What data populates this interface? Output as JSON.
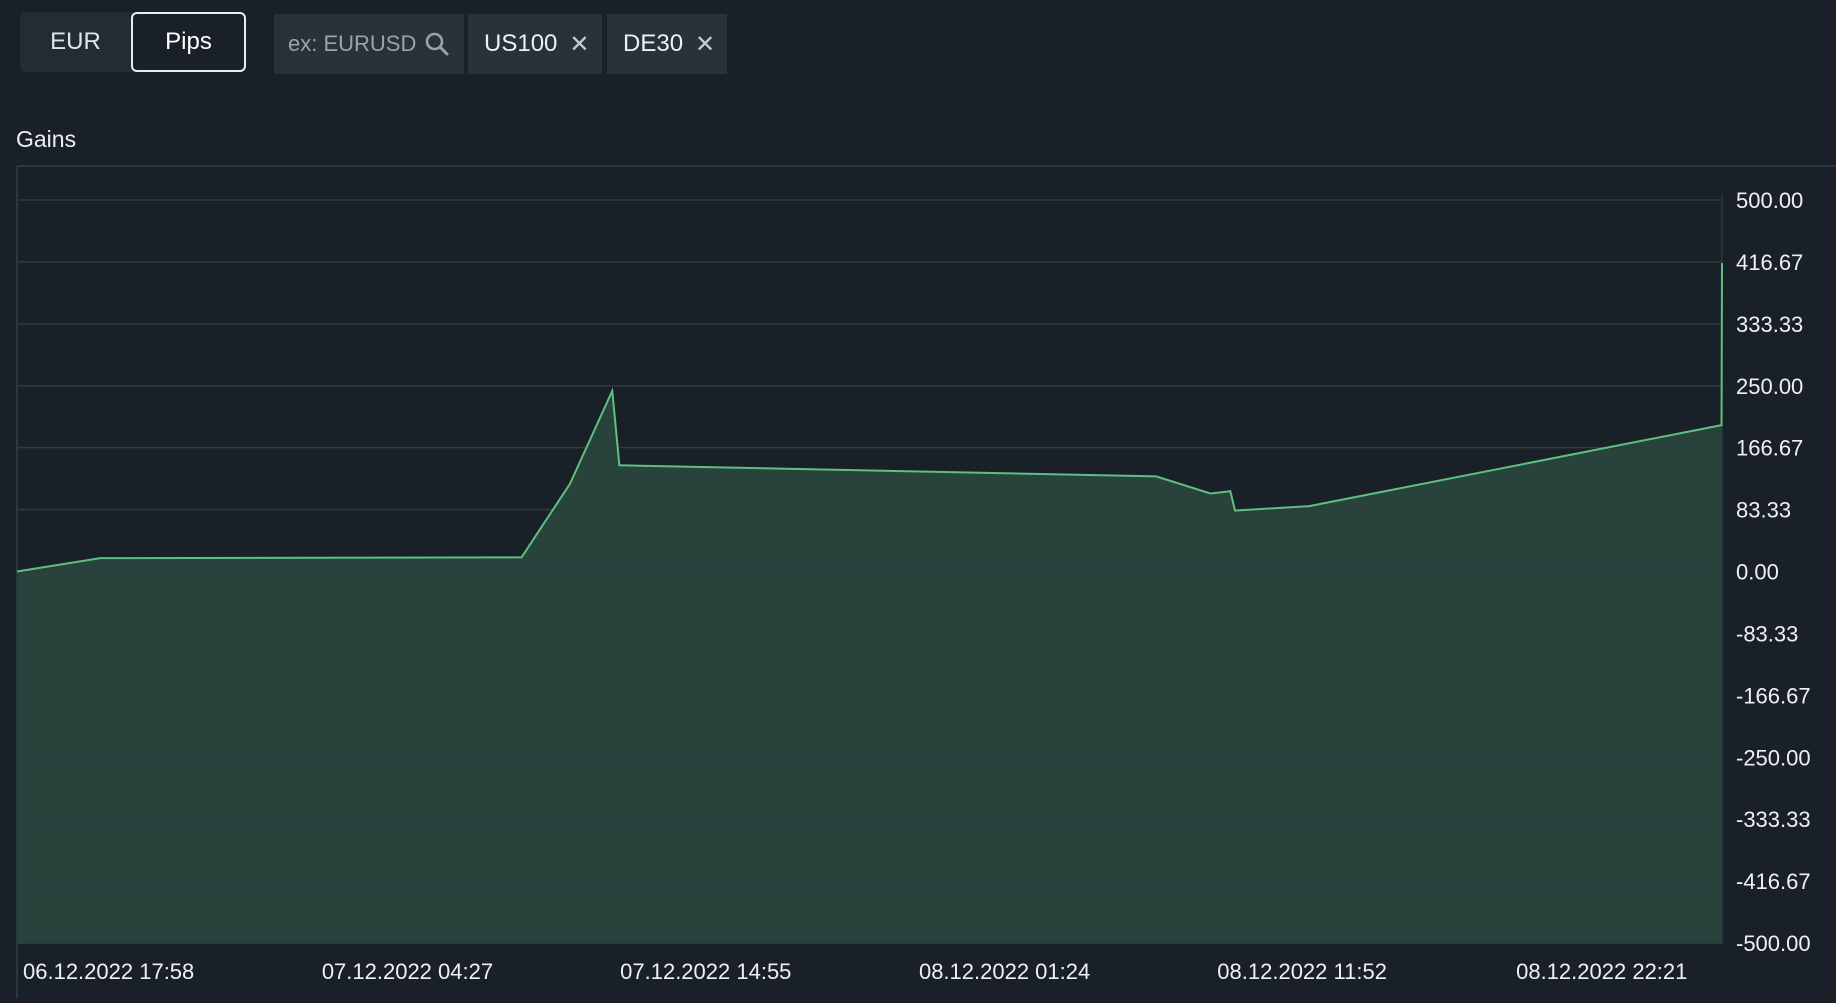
{
  "toggle": {
    "options": [
      "EUR",
      "Pips"
    ],
    "selected": "Pips"
  },
  "search": {
    "placeholder": "ex: EURUSD",
    "value": ""
  },
  "tags": [
    {
      "label": "US100",
      "remove_icon": "close-icon"
    },
    {
      "label": "DE30",
      "remove_icon": "close-icon"
    }
  ],
  "colors": {
    "background": "#1a2028",
    "line": "#5fbf7f",
    "fill": "#2b4a3f",
    "grid": "#2e3b3f"
  },
  "chart_data": {
    "type": "area",
    "title": "Gains",
    "xlabel": "",
    "ylabel": "",
    "ylim": [
      -500,
      500
    ],
    "yticks": [
      "500.00",
      "416.67",
      "333.33",
      "250.00",
      "166.67",
      "83.33",
      "0.00",
      "-83.33",
      "-166.67",
      "-250.00",
      "-333.33",
      "-416.67",
      "-500.00"
    ],
    "xticks": [
      "06.12.2022 17:58",
      "07.12.2022 04:27",
      "07.12.2022 14:55",
      "08.12.2022 01:24",
      "08.12.2022 11:52",
      "08.12.2022 22:21"
    ],
    "grid": true,
    "series": [
      {
        "points": [
          {
            "t": "06.12.2022 17:58",
            "y": 0
          },
          {
            "t": "06.12.2022 20:53",
            "y": 18
          },
          {
            "t": "07.12.2022 11:40",
            "y": 19
          },
          {
            "t": "07.12.2022 13:22",
            "y": 118
          },
          {
            "t": "07.12.2022 14:51",
            "y": 243
          },
          {
            "t": "07.12.2022 15:06",
            "y": 143
          },
          {
            "t": "08.12.2022 09:56",
            "y": 128
          },
          {
            "t": "08.12.2022 11:50",
            "y": 105
          },
          {
            "t": "08.12.2022 12:32",
            "y": 108
          },
          {
            "t": "08.12.2022 12:42",
            "y": 82
          },
          {
            "t": "08.12.2022 15:18",
            "y": 88
          },
          {
            "t": "09.12.2022 05:46",
            "y": 197
          },
          {
            "t": "09.12.2022 05:47",
            "y": 415
          }
        ]
      }
    ]
  }
}
